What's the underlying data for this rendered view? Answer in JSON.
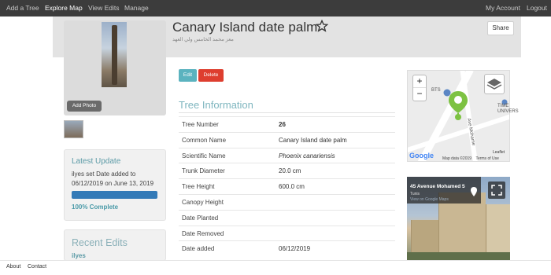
{
  "nav": {
    "items": [
      {
        "label": "Add a Tree",
        "active": false
      },
      {
        "label": "Explore Map",
        "active": true
      },
      {
        "label": "View Edits",
        "active": false
      },
      {
        "label": "Manage",
        "active": false
      }
    ],
    "my_account": "My Account",
    "logout": "Logout"
  },
  "header": {
    "title": "Canary Island date palm",
    "subtitle": "معز محمد الخامس ولي العهد",
    "share_label": "Share",
    "favorite_icon": "star-outline-icon"
  },
  "photo": {
    "add_photo_label": "Add Photo"
  },
  "actions": {
    "edit_label": "Edit",
    "delete_label": "Delete",
    "edit_color": "#5bb3bf",
    "delete_color": "#de3e2f"
  },
  "tree_info": {
    "title": "Tree Information",
    "rows": [
      {
        "label": "Tree Number",
        "value": "26"
      },
      {
        "label": "Common Name",
        "value": "Canary Island date palm"
      },
      {
        "label": "Scientific Name",
        "value": "Phoenix canariensis"
      },
      {
        "label": "Trunk Diameter",
        "value": "20.0 cm"
      },
      {
        "label": "Tree Height",
        "value": "600.0 cm"
      },
      {
        "label": "Canopy Height",
        "value": ""
      },
      {
        "label": "Date Planted",
        "value": ""
      },
      {
        "label": "Date Removed",
        "value": ""
      },
      {
        "label": "Date added",
        "value": "06/12/2019"
      }
    ]
  },
  "latest_update": {
    "title": "Latest Update",
    "text": "ilyes set Date added to 06/12/2019 on June 13, 2019",
    "progress": 1.0,
    "progress_label": "100% Complete"
  },
  "recent_edits": {
    "title": "Recent Edits",
    "first_user": "ilyes"
  },
  "map": {
    "zoom_in": "+",
    "zoom_out": "−",
    "poi_bts": "BTS",
    "poi_time": "TIME UNIVERS",
    "street_label": "Ave Mohame",
    "street_label2": "Ave Mohamed",
    "google": "Google",
    "attribution": "Map data ©2019",
    "terms": "Terms of Use",
    "leaflet": "Leaflet"
  },
  "street_view": {
    "address": "45 Avenue Mohamed 5",
    "city": "Tunis",
    "link": "View on Google Maps"
  },
  "footer": {
    "about": "About",
    "contact": "Contact"
  }
}
